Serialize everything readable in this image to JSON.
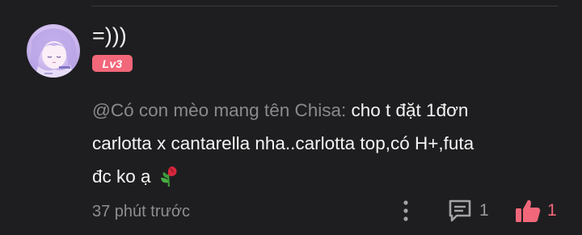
{
  "comment": {
    "username": "=)))",
    "level_badge": "Lv3",
    "mention": "@Có con mèo mang tên Chisa:",
    "text_line1": " cho t đặt 1đơn",
    "text_line2": "carlotta x cantarella nha..carlotta top,có H+,futa",
    "text_line3": "đc ko ạ",
    "emoji": "wilted-rose",
    "timestamp": "37 phút trước",
    "reply_count": "1",
    "like_count": "1"
  },
  "colors": {
    "background": "#1e1e20",
    "accent": "#f2677a",
    "muted": "#8e8e90"
  },
  "icons": {
    "more": "more-vertical-icon",
    "reply": "comment-bubble-icon",
    "like": "thumbs-up-icon"
  }
}
